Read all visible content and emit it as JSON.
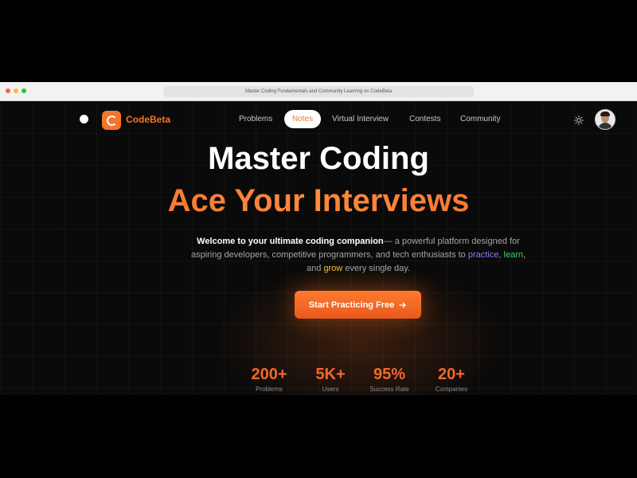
{
  "browser": {
    "address_text": "Master Coding Fundamentals and Community Learning on CodeBeta",
    "traffic_lights": [
      "#ff5f57",
      "#febc2e",
      "#28c840"
    ]
  },
  "brand": {
    "name": "CodeBeta",
    "logo_icon": "codebeta-logo-icon",
    "color": "#f5752a"
  },
  "nav": {
    "items": [
      {
        "label": "Problems"
      },
      {
        "label": "Notes"
      },
      {
        "label": "Virtual Interview"
      },
      {
        "label": "Contests"
      },
      {
        "label": "Community"
      }
    ],
    "active": "Notes",
    "theme_icon": "sun-icon",
    "avatar_icon": "user-avatar"
  },
  "hero": {
    "title_line1": "Master Coding",
    "title_line2": "Ace Your Interviews",
    "desc_bold": "Welcome to your ultimate coding companion",
    "desc_part1": "— a powerful platform designed for aspiring developers, competitive programmers, and tech enthusiasts to ",
    "word_practice": "practice",
    "desc_comma": ", ",
    "word_learn": "learn",
    "desc_and": ", and ",
    "word_grow": "grow",
    "desc_end": " every single day.",
    "cta_label": "Start Practicing Free",
    "cta_icon": "arrow-right-icon",
    "accent_color": "#f2682a"
  },
  "stats": [
    {
      "value": "200+",
      "label": "Problems"
    },
    {
      "value": "5K+",
      "label": "Users"
    },
    {
      "value": "95%",
      "label": "Success Rate"
    },
    {
      "value": "20+",
      "label": "Companies"
    }
  ]
}
